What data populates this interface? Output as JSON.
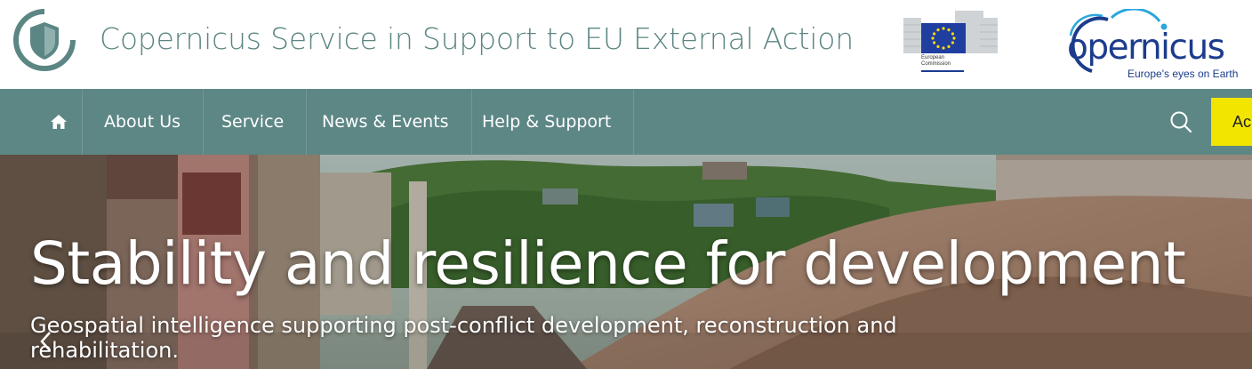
{
  "header": {
    "title": "Copernicus Service in Support to EU External Action",
    "eu_logo_caption": "European Commission",
    "copernicus_logo_word": "opernicus",
    "copernicus_tagline": "Europe's eyes on Earth",
    "brand_color": "#5d8785"
  },
  "nav": {
    "home_icon": "home-icon",
    "items": [
      {
        "label": "About Us"
      },
      {
        "label": "Service"
      },
      {
        "label": "News & Events"
      },
      {
        "label": "Help & Support"
      }
    ],
    "search_icon": "search-icon",
    "cta_label": "Ac",
    "cta_color": "#f2e600"
  },
  "hero": {
    "title": "Stability and resilience for development",
    "subtitle": "Geospatial intelligence supporting post-conflict development, reconstruction and rehabilitation.",
    "prev_icon": "chevron-left-icon"
  }
}
